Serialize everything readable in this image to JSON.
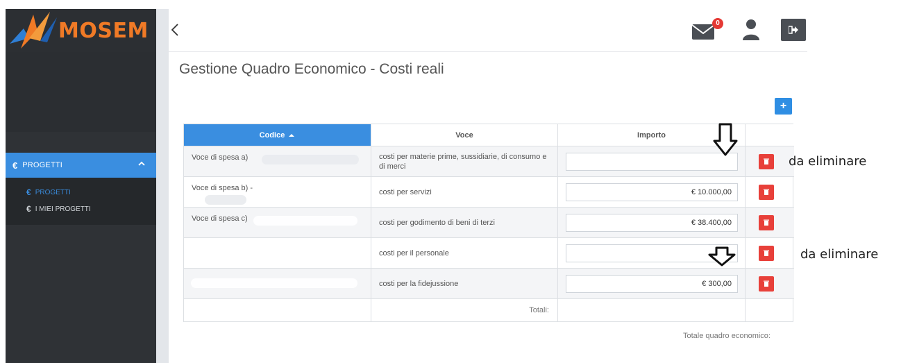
{
  "app": {
    "logo_text": "MOSEM"
  },
  "sidebar": {
    "main_item": {
      "icon": "€",
      "label": "PROGETTI"
    },
    "sub_items": [
      {
        "icon": "€",
        "label": "PROGETTI",
        "active": true
      },
      {
        "icon": "€",
        "label": "I MIEI PROGETTI",
        "active": false
      }
    ]
  },
  "topbar": {
    "mail_badge": "0"
  },
  "page": {
    "title": "Gestione Quadro Economico - Costi reali",
    "add_label": "+"
  },
  "table": {
    "headers": {
      "codice": "Codice",
      "voce": "Voce",
      "importo": "Importo"
    },
    "rows": [
      {
        "codice": "Voce di spesa a)",
        "voce": "costi per materie prime, sussidiarie, di consumo e di merci",
        "importo": ""
      },
      {
        "codice": "Voce di spesa b) -",
        "voce": "costi per servizi",
        "importo": "€ 10.000,00"
      },
      {
        "codice": "Voce di spesa c)",
        "voce": "costi per godimento di beni di terzi",
        "importo": "€ 38.400,00"
      },
      {
        "codice": "",
        "voce": "costi per il personale",
        "importo": ""
      },
      {
        "codice": "",
        "voce": "costi per la fidejussione",
        "importo": "€ 300,00"
      }
    ],
    "totals_label": "Totali:"
  },
  "footer": {
    "totale_label": "Totale quadro economico:"
  },
  "annotations": {
    "first": "da eliminare",
    "second": "da eliminare"
  },
  "colors": {
    "accent": "#3a8ee0",
    "danger": "#e8403a",
    "logo": "#f07a26",
    "sidebar": "#2c2f33"
  }
}
